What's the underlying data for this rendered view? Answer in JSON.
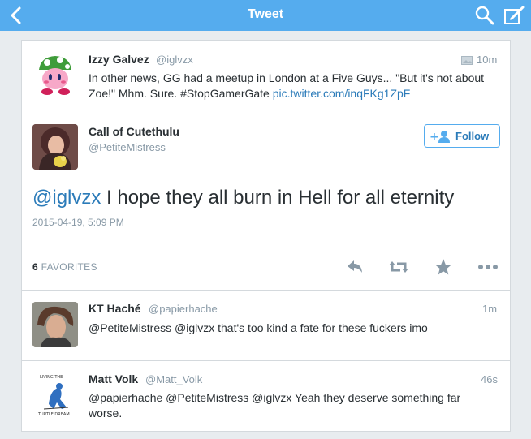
{
  "topbar": {
    "title": "Tweet",
    "back_icon": "chevron-left-icon",
    "search_icon": "search-icon",
    "compose_icon": "compose-icon",
    "color": "#55acee"
  },
  "in_reply_to": {
    "name": "Izzy Galvez",
    "handle": "@iglvzx",
    "time": "10m",
    "text_before": "In other news, GG had a meetup in London at a Five Guys... \"But it's not about Zoe!\" Mhm. Sure. #StopGamerGate ",
    "link": "pic.twitter.com/inqFKg1ZpF"
  },
  "main_tweet": {
    "name": "Call of Cutethulu",
    "handle": "@PetiteMistress",
    "follow_label": "Follow",
    "mention": "@iglvzx",
    "text": " I hope they all burn in Hell for all eternity",
    "timestamp": "2015-04-19, 5:09 PM",
    "favorites_count": "6",
    "favorites_label": "FAVORITES",
    "actions": [
      "reply-icon",
      "retweet-icon",
      "favorite-star-icon",
      "more-icon"
    ]
  },
  "replies": [
    {
      "name": "KT Haché",
      "handle": "@papierhache",
      "time": "1m",
      "text": "@PetiteMistress @iglvzx that's too kind a fate for these fuckers imo"
    },
    {
      "name": "Matt Volk",
      "handle": "@Matt_Volk",
      "time": "46s",
      "text_line1": "@papierhache @PetiteMistress @iglvzx Yeah they deserve something far",
      "text_line2": "worse.",
      "avatar_top": "LIVING THE",
      "avatar_bottom": "TURTLE DREAM"
    }
  ]
}
